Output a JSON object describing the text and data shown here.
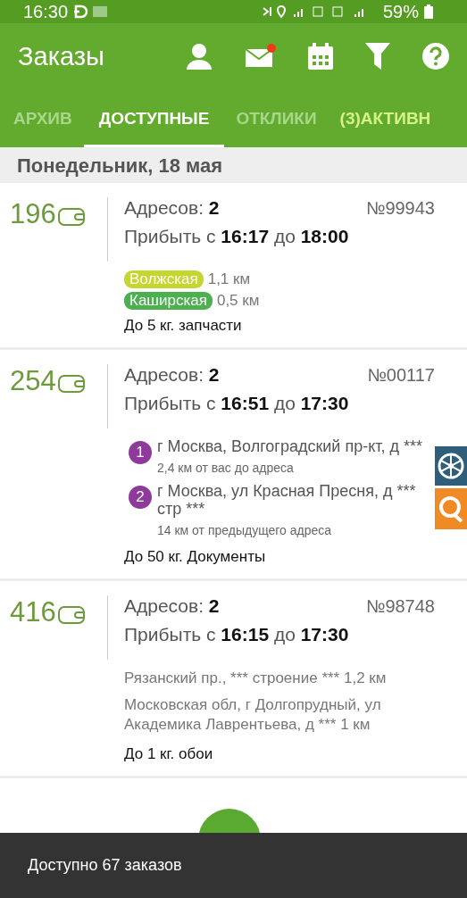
{
  "status_bar": {
    "time": "16:30",
    "battery": "59%"
  },
  "app_bar": {
    "title": "Заказы",
    "mail_unread": true
  },
  "tabs": [
    {
      "label": "АРХИВ",
      "selected": false,
      "highlighted": false
    },
    {
      "label": "ДОСТУПНЫЕ",
      "selected": true,
      "highlighted": false
    },
    {
      "label": "ОТКЛИКИ",
      "selected": false,
      "highlighted": false
    },
    {
      "label": "(3)АКТИВН",
      "selected": false,
      "highlighted": true
    }
  ],
  "date_header": "Понедельник, 18 мая",
  "orders": [
    {
      "price": "196",
      "addresses": "Адресов: **2**",
      "number": "№99943",
      "arrive": "Прибыть с **16:17** до **18:00**",
      "details": [
        {
          "kind": "station",
          "name": "Волжская",
          "color": "#c5d630",
          "distance": "1,1 км"
        },
        {
          "kind": "station",
          "name": "Каширская",
          "color": "#4caf50",
          "distance": "0,5 км"
        }
      ],
      "cargo": "До 5 кг. запчасти"
    },
    {
      "price": "254",
      "addresses": "Адресов: **2**",
      "number": "№00117",
      "arrive": "Прибыть с **16:51** до **17:30**",
      "details": [
        {
          "kind": "address",
          "index": "1",
          "text": "г Москва, Волгоградский пр-кт, д ***",
          "note": "2,4 км от вас до адреса"
        },
        {
          "kind": "address",
          "index": "2",
          "text": "г Москва, ул Красная Пресня, д *** стр ***",
          "note": "14 км от предыдущего адреса"
        }
      ],
      "cargo": "До 50 кг. Документы"
    },
    {
      "price": "416",
      "addresses": "Адресов: **2**",
      "number": "№98748",
      "arrive": "Прибыть с **16:15** до **17:30**",
      "details": [
        {
          "kind": "line",
          "text": "Рязанский пр., *** строение *** 1,2 км"
        },
        {
          "kind": "line",
          "text": "Московская обл, г Долгопрудный, ул Академика Лаврентьева, д *** 1 км"
        }
      ],
      "cargo": "До 1 кг. обои"
    }
  ],
  "snackbar": "Доступно 67 заказов"
}
